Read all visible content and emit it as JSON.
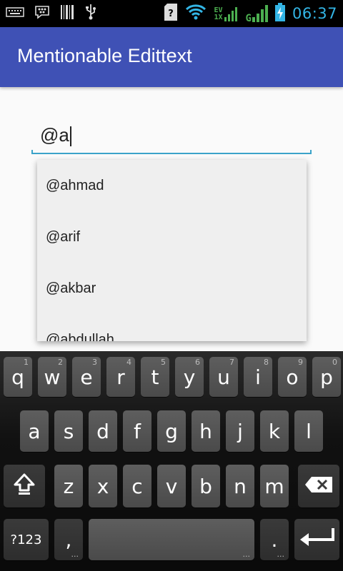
{
  "status_bar": {
    "time": "06:37",
    "network_type": "EV 1X",
    "signal_type": "G",
    "icons": [
      "keyboard-icon",
      "bbm-icon",
      "barcode-icon",
      "usb-icon",
      "sd-card-icon",
      "wifi-icon",
      "signal-icon",
      "battery-charging-icon"
    ]
  },
  "app_bar": {
    "title": "Mentionable Edittext"
  },
  "edit_text": {
    "value": "@a"
  },
  "suggestions": [
    "@ahmad",
    "@arif",
    "@akbar",
    "@abdullah"
  ],
  "keyboard": {
    "row1": [
      {
        "key": "q",
        "hint": "1"
      },
      {
        "key": "w",
        "hint": "2"
      },
      {
        "key": "e",
        "hint": "3"
      },
      {
        "key": "r",
        "hint": "4"
      },
      {
        "key": "t",
        "hint": "5"
      },
      {
        "key": "y",
        "hint": "6"
      },
      {
        "key": "u",
        "hint": "7"
      },
      {
        "key": "i",
        "hint": "8"
      },
      {
        "key": "o",
        "hint": "9"
      },
      {
        "key": "p",
        "hint": "0"
      }
    ],
    "row2": [
      "a",
      "s",
      "d",
      "f",
      "g",
      "h",
      "j",
      "k",
      "l"
    ],
    "row3": [
      "z",
      "x",
      "c",
      "v",
      "b",
      "n",
      "m"
    ],
    "symbols_label": "?123",
    "comma_label": ",",
    "period_label": ".",
    "dots_hint": "..."
  },
  "colors": {
    "app_bar": "#3f51b5",
    "edit_underline": "#3ba3c9",
    "time": "#33b5e5",
    "network": "#4caf50"
  }
}
